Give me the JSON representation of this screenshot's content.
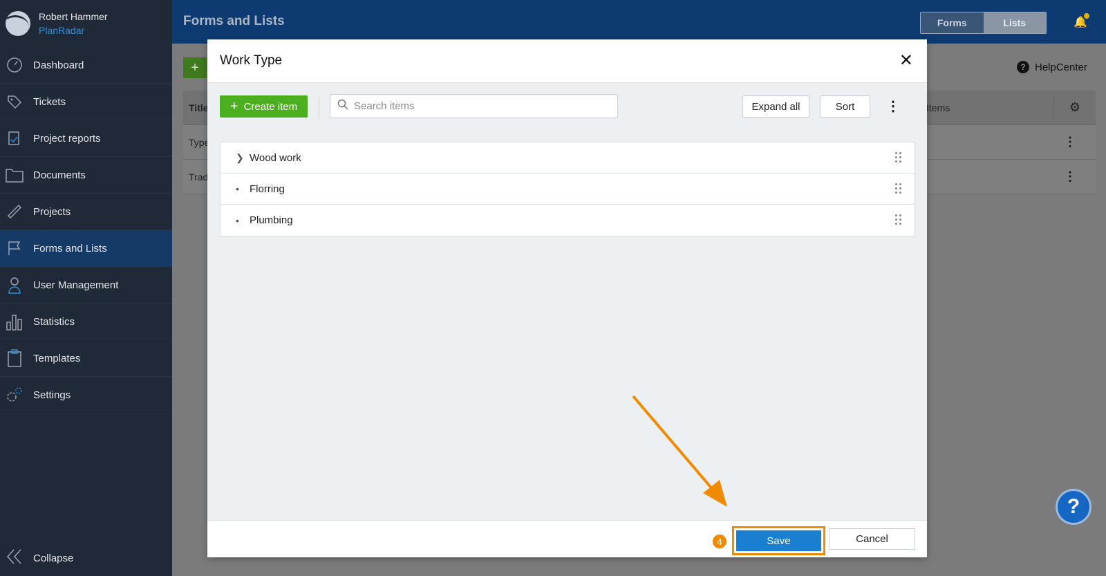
{
  "user": {
    "name": "Robert Hammer",
    "company": "PlanRadar"
  },
  "sidebar": {
    "items": [
      {
        "label": "Dashboard",
        "icon": "dashboard-icon"
      },
      {
        "label": "Tickets",
        "icon": "ticket-icon"
      },
      {
        "label": "Project reports",
        "icon": "report-icon"
      },
      {
        "label": "Documents",
        "icon": "folder-icon"
      },
      {
        "label": "Projects",
        "icon": "ruler-icon"
      },
      {
        "label": "Forms and Lists",
        "icon": "flag-icon",
        "active": true
      },
      {
        "label": "User Management",
        "icon": "user-icon"
      },
      {
        "label": "Statistics",
        "icon": "bar-chart-icon"
      },
      {
        "label": "Templates",
        "icon": "clipboard-icon"
      },
      {
        "label": "Settings",
        "icon": "gear-icon"
      }
    ],
    "collapse_label": "Collapse"
  },
  "header": {
    "title": "Forms and Lists",
    "tabs": [
      "Forms",
      "Lists"
    ],
    "active_tab": "Forms"
  },
  "background": {
    "help_label": "HelpCenter",
    "table_header_title": "Title",
    "table_header_items": "Items",
    "rows": [
      "Type",
      "Trad"
    ]
  },
  "modal": {
    "title": "Work Type",
    "create_label": "Create item",
    "search_placeholder": "Search items",
    "expand_label": "Expand all",
    "sort_label": "Sort",
    "items": [
      {
        "label": "Wood work",
        "expandable": true
      },
      {
        "label": "Florring",
        "expandable": false
      },
      {
        "label": "Plumbing",
        "expandable": false
      }
    ],
    "save_label": "Save",
    "cancel_label": "Cancel",
    "step_number": "4"
  },
  "colors": {
    "accent_orange": "#f08a00",
    "save_blue": "#1a7fd0",
    "create_green": "#4caf1f",
    "sidebar": "#1f2937",
    "header": "#0d3a70"
  }
}
